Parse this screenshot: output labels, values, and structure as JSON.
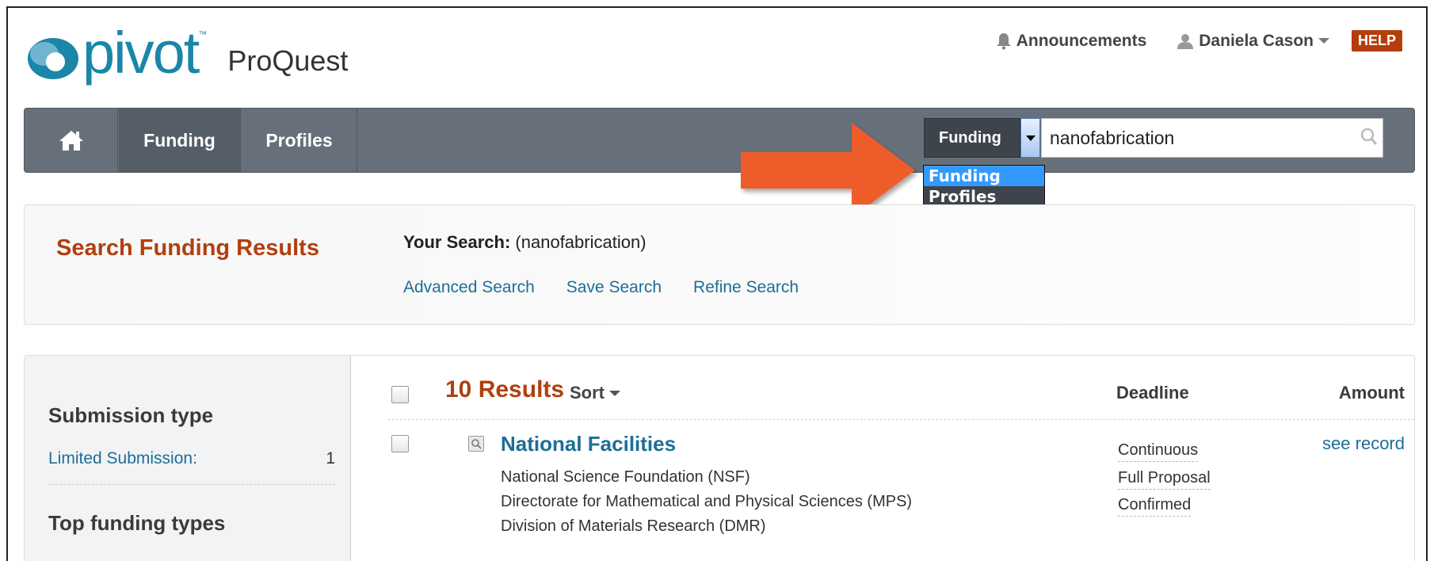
{
  "header": {
    "logo_text": "pivot",
    "logo_tm": "™",
    "logo_sub": "ProQuest",
    "announcements": "Announcements",
    "user_name": "Daniela Cason",
    "help": "HELP"
  },
  "nav": {
    "tabs": [
      {
        "label": "Funding",
        "active": true
      },
      {
        "label": "Profiles",
        "active": false
      }
    ]
  },
  "search": {
    "scope_selected": "Funding",
    "query": "nanofabrication",
    "scope_options": [
      "Funding",
      "Profiles"
    ]
  },
  "results_header": {
    "title": "Search Funding Results",
    "your_search_label": "Your Search:",
    "your_search_value": " (nanofabrication)",
    "links": [
      "Advanced Search",
      "Save Search",
      "Refine Search"
    ]
  },
  "sidebar": {
    "submission_heading": "Submission type",
    "limited_label": "Limited Submission:",
    "limited_count": "1",
    "top_funding_heading": "Top funding types"
  },
  "results": {
    "count_label": "10 Results",
    "sort_label": "Sort",
    "col_deadline": "Deadline",
    "col_amount": "Amount",
    "items": [
      {
        "title": "National Facilities",
        "lines": [
          "National Science Foundation (NSF)",
          "Directorate for Mathematical and Physical Sciences (MPS)",
          "Division of Materials Research (DMR)"
        ],
        "deadline": [
          "Continuous",
          "Full Proposal",
          "Confirmed"
        ],
        "amount": "see record"
      }
    ]
  },
  "colors": {
    "brand_blue": "#1a86a8",
    "accent_orange": "#b0400f",
    "nav_gray": "#67707a",
    "arrow_orange": "#ee5b2b"
  }
}
